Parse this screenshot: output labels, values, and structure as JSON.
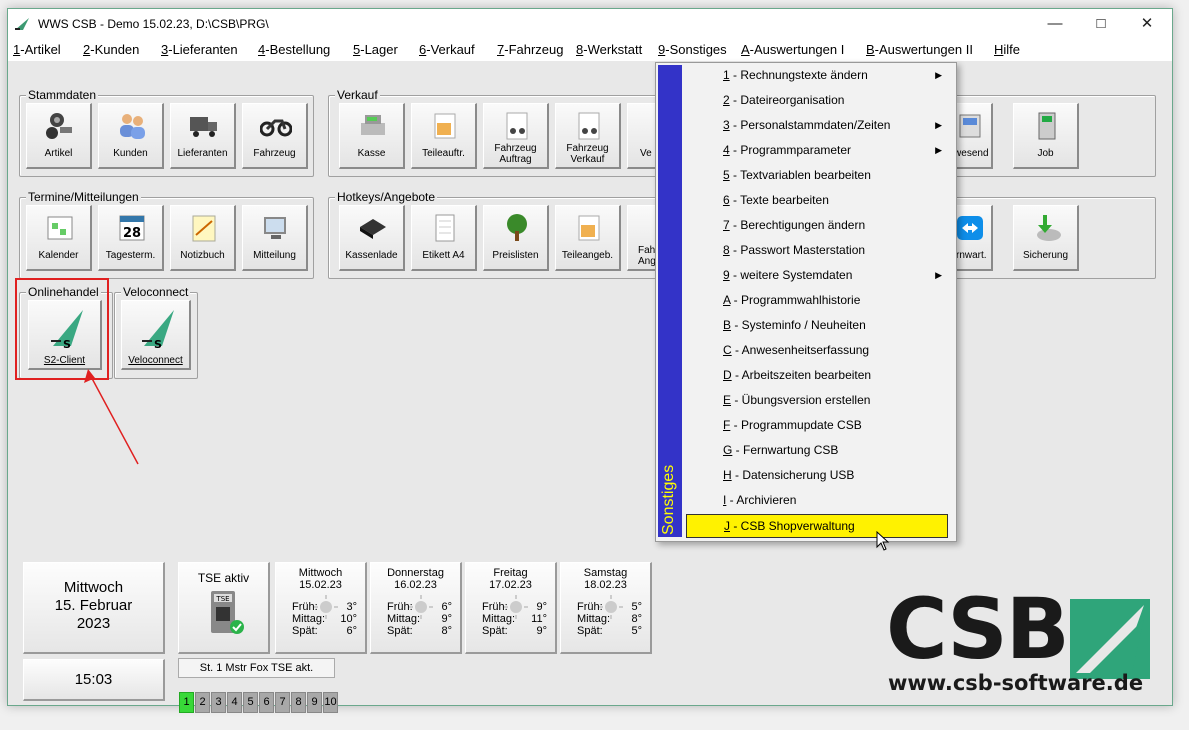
{
  "window": {
    "title": "WWS CSB - Demo  15.02.23, D:\\CSB\\PRG\\"
  },
  "menu": [
    {
      "key": "1",
      "label": "-Artikel"
    },
    {
      "key": "2",
      "label": "-Kunden"
    },
    {
      "key": "3",
      "label": "-Lieferanten"
    },
    {
      "key": "4",
      "label": "-Bestellung"
    },
    {
      "key": "5",
      "label": "-Lager"
    },
    {
      "key": "6",
      "label": "-Verkauf"
    },
    {
      "key": "7",
      "label": "-Fahrzeug"
    },
    {
      "key": "8",
      "label": "-Werkstatt"
    },
    {
      "key": "9",
      "label": "-Sonstiges"
    },
    {
      "key": "A",
      "label": "-Auswertungen I"
    },
    {
      "key": "B",
      "label": "-Auswertungen II"
    },
    {
      "key": "H",
      "label": "ilfe"
    }
  ],
  "groups": {
    "stammdaten": {
      "label": "Stammdaten",
      "tiles": [
        "Artikel",
        "Kunden",
        "Lieferanten",
        "Fahrzeug"
      ]
    },
    "verkauf": {
      "label": "Verkauf",
      "tiles": [
        "Kasse",
        "Teileauftr.",
        "Fahrzeug Auftrag",
        "Fahrzeug Verkauf",
        "Ve"
      ],
      "right_tiles": [
        "nwesend",
        "Job"
      ]
    },
    "termine": {
      "label": "Termine/Mitteilungen",
      "tiles": [
        "Kalender",
        "Tagesterm.",
        "Notizbuch",
        "Mitteilung"
      ],
      "calendar_day": "28"
    },
    "hotkeys": {
      "label": "Hotkeys/Angebote",
      "tiles": [
        "Kassenlade",
        "Etikett A4",
        "Preislisten",
        "Teileangeb.",
        "Fah Ang"
      ],
      "right_tiles": [
        "ernwart.",
        "Sicherung"
      ]
    },
    "onlinehandel": {
      "label": "Onlinehandel",
      "tiles": [
        "S2-Client"
      ]
    },
    "veloconnect": {
      "label": "Veloconnect",
      "tiles": [
        "Veloconnect"
      ]
    }
  },
  "date_panel": {
    "weekday": "Mittwoch",
    "date": "15. Februar",
    "year": "2023",
    "time": "15:03"
  },
  "tse": {
    "label": "TSE aktiv",
    "chip": "TSE",
    "status_line": "St. 1 Mstr Fox TSE akt."
  },
  "weather": [
    {
      "day": "Mittwoch",
      "date": "15.02.23",
      "frueh": "3°",
      "mittag": "10°",
      "spaet": "6°"
    },
    {
      "day": "Donnerstag",
      "date": "16.02.23",
      "frueh": "6°",
      "mittag": "9°",
      "spaet": "8°"
    },
    {
      "day": "Freitag",
      "date": "17.02.23",
      "frueh": "9°",
      "mittag": "11°",
      "spaet": "9°"
    },
    {
      "day": "Samstag",
      "date": "18.02.23",
      "frueh": "5°",
      "mittag": "8°",
      "spaet": "5°"
    }
  ],
  "weather_labels": {
    "frueh": "Früh:",
    "mittag": "Mittag:",
    "spaet": "Spät:"
  },
  "pages": [
    "1",
    "2",
    "3",
    "4",
    "5",
    "6",
    "7",
    "8",
    "9",
    "10"
  ],
  "logo": {
    "text": "CSB",
    "url": "www.csb-software.de"
  },
  "dropdown": {
    "side_label": "Sonstiges",
    "items": [
      {
        "key": "1",
        "label": " - Rechnungstexte ändern",
        "submenu": true
      },
      {
        "key": "2",
        "label": " - Dateireorganisation",
        "submenu": false
      },
      {
        "key": "3",
        "label": " - Personalstammdaten/Zeiten",
        "submenu": true
      },
      {
        "key": "4",
        "label": " - Programmparameter",
        "submenu": true
      },
      {
        "key": "5",
        "label": " - Textvariablen bearbeiten",
        "submenu": false
      },
      {
        "key": "6",
        "label": " - Texte bearbeiten",
        "submenu": false
      },
      {
        "key": "7",
        "label": " - Berechtigungen ändern",
        "submenu": false
      },
      {
        "key": "8",
        "label": " - Passwort Masterstation",
        "submenu": false
      },
      {
        "key": "9",
        "label": " - weitere Systemdaten",
        "submenu": true
      },
      {
        "key": "A",
        "label": " - Programmwahlhistorie",
        "submenu": false
      },
      {
        "key": "B",
        "label": " - Systeminfo / Neuheiten",
        "submenu": false
      },
      {
        "key": "C",
        "label": " - Anwesenheitserfassung",
        "submenu": false
      },
      {
        "key": "D",
        "label": " - Arbeitszeiten bearbeiten",
        "submenu": false
      },
      {
        "key": "E",
        "label": " - Übungsversion erstellen",
        "submenu": false
      },
      {
        "key": "F",
        "label": " - Programmupdate CSB",
        "submenu": false
      },
      {
        "key": "G",
        "label": " - Fernwartung CSB",
        "submenu": false
      },
      {
        "key": "H",
        "label": " - Datensicherung USB",
        "submenu": false
      },
      {
        "key": "I",
        "label": " - Archivieren",
        "submenu": false
      },
      {
        "key": "J",
        "label": " - CSB Shopverwaltung",
        "submenu": false
      }
    ],
    "highlighted": "J"
  },
  "colors": {
    "accent": "#2fa57a",
    "dropdown_side": "#3333c8",
    "highlight": "#fff200",
    "callout": "#e02020"
  }
}
